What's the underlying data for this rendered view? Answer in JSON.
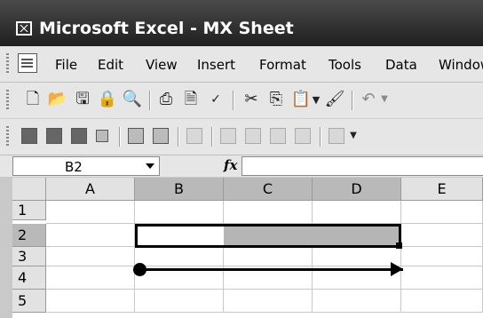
{
  "window": {
    "title": "Microsoft Excel - MX Sheet"
  },
  "menu": {
    "items": [
      "File",
      "Edit",
      "View",
      "Insert",
      "Format",
      "Tools",
      "Data",
      "Window"
    ]
  },
  "formula_bar": {
    "name_box": "B2",
    "fx_label": "fx",
    "formula": ""
  },
  "grid": {
    "columns": [
      "A",
      "B",
      "C",
      "D",
      "E"
    ],
    "rows": [
      "1",
      "2",
      "3",
      "4",
      "5"
    ],
    "selected_columns": [
      "B",
      "C",
      "D"
    ],
    "selected_row": "2",
    "active_cell": "B2",
    "selected_range": "B2:D2"
  },
  "toolbar_icons": {
    "standard": [
      "new-icon",
      "open-icon",
      "save-icon",
      "permission-icon",
      "research-icon",
      "print-icon",
      "print-preview-icon",
      "spelling-icon",
      "cut-icon",
      "copy-icon",
      "paste-icon",
      "paste-dropdown-icon",
      "format-painter-icon",
      "undo-icon"
    ],
    "secondary": [
      "sheet-icon",
      "table-icon",
      "report-icon",
      "small-square-icon",
      "form-icon",
      "form2-icon",
      "border-icon",
      "grid1-icon",
      "grid2-icon",
      "grid3-icon",
      "grid4-icon",
      "chart-icon",
      "more-icon"
    ]
  },
  "colors": {
    "titlebar": "#2b2b2b",
    "selection": "#b5b5b5",
    "header_selected": "#b9b9b9"
  }
}
